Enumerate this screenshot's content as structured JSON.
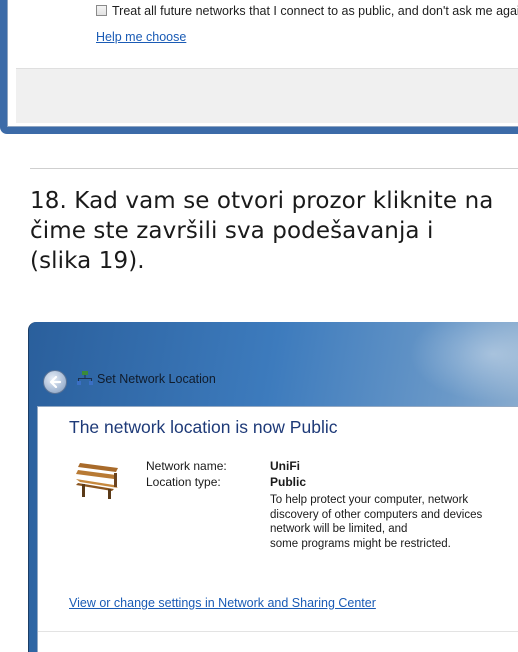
{
  "top_window": {
    "checkbox_label": "Treat all future networks that I connect to as public, and don't ask me again",
    "help_link": "Help me choose"
  },
  "instruction": {
    "text": "18. Kad vam se otvori  prozor kliknite na\nčime ste završili sva podešavanja i\n(slika 19)."
  },
  "dialog": {
    "title": "Set Network Location",
    "heading": "The network location is now Public",
    "network_name_label": "Network name:",
    "network_name_value": "UniFi",
    "location_type_label": "Location type:",
    "location_type_value": "Public",
    "description": "To help protect your computer, network\ndiscovery of other computers and devices\nnetwork will be limited, and\nsome programs might be restricted.",
    "sharing_link": "View or change settings in Network and Sharing Center",
    "icons": [
      "back-arrow-icon",
      "network-icon",
      "bench-icon"
    ]
  },
  "colors": {
    "link": "#1a5bb5",
    "heading": "#1e3a78",
    "aero_blue": "#3d7bbd"
  }
}
